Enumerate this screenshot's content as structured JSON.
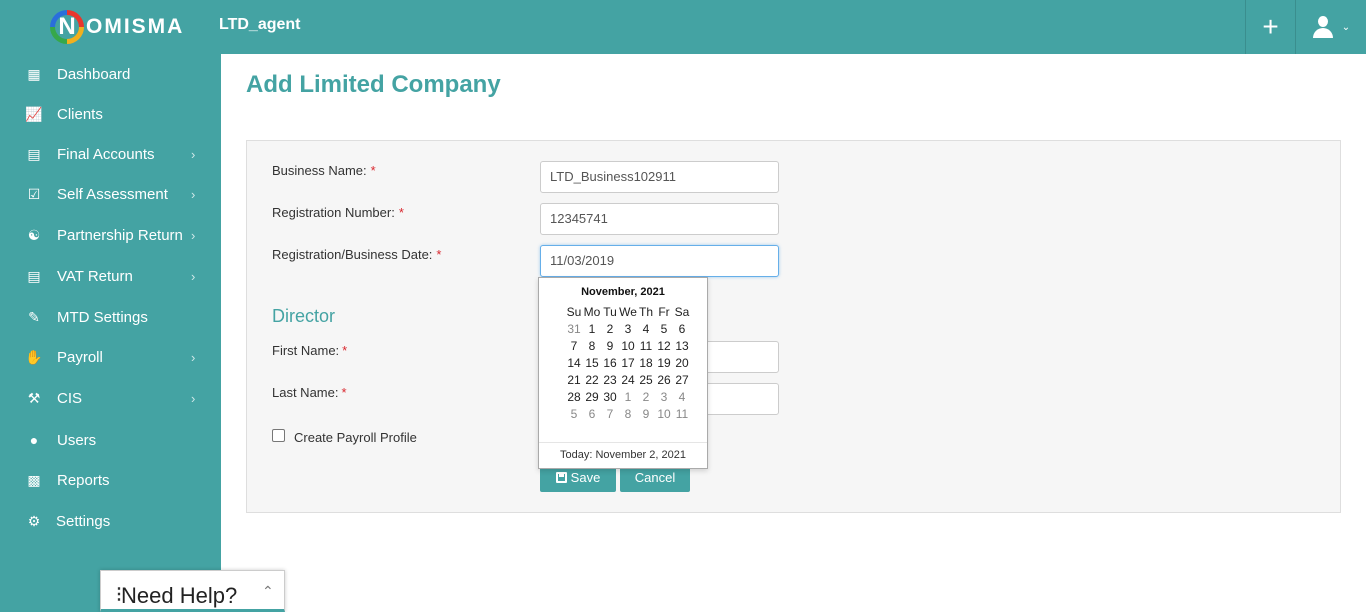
{
  "header": {
    "logo_text": "OMISMA",
    "logo_letter": "N",
    "app_title": "LTD_agent",
    "plus_icon": "plus-icon",
    "user_icon": "user-icon"
  },
  "sidebar": {
    "items": [
      {
        "label": "Dashboard",
        "icon": "dashboard-icon",
        "chevron": false
      },
      {
        "label": "Clients",
        "icon": "chart-icon",
        "chevron": false
      },
      {
        "label": "Final Accounts",
        "icon": "document-icon",
        "chevron": true
      },
      {
        "label": "Self Assessment",
        "icon": "checklist-icon",
        "chevron": true
      },
      {
        "label": "Partnership Return",
        "icon": "handshake-icon",
        "chevron": true
      },
      {
        "label": "VAT Return",
        "icon": "vat-icon",
        "chevron": true
      },
      {
        "label": "MTD Settings",
        "icon": "ledger-icon",
        "chevron": false
      },
      {
        "label": "Payroll",
        "icon": "payroll-icon",
        "chevron": true
      },
      {
        "label": "CIS",
        "icon": "tools-icon",
        "chevron": true
      },
      {
        "label": "Users",
        "icon": "user-icon",
        "chevron": false
      },
      {
        "label": "Reports",
        "icon": "clipboard-icon",
        "chevron": false
      },
      {
        "label": "Settings",
        "icon": "gear-icon",
        "chevron": false
      }
    ]
  },
  "main": {
    "title": "Add Limited Company",
    "form": {
      "business_name_label": "Business Name:",
      "business_name_value": "LTD_Business102911",
      "registration_number_label": "Registration Number:",
      "registration_number_value": "12345741",
      "registration_date_label": "Registration/Business Date:",
      "registration_date_value": "11/03/2019",
      "required_mark": "*",
      "director_heading": "Director",
      "first_name_label": "First Name:",
      "last_name_label": "Last Name:",
      "create_payroll_label": "Create Payroll Profile",
      "save_label": "Save",
      "cancel_label": "Cancel"
    }
  },
  "datepicker": {
    "title": "November, 2021",
    "weekdays": [
      "Su",
      "Mo",
      "Tu",
      "We",
      "Th",
      "Fr",
      "Sa"
    ],
    "weeks": [
      [
        {
          "d": "31",
          "m": true
        },
        {
          "d": "1"
        },
        {
          "d": "2"
        },
        {
          "d": "3"
        },
        {
          "d": "4"
        },
        {
          "d": "5"
        },
        {
          "d": "6"
        }
      ],
      [
        {
          "d": "7"
        },
        {
          "d": "8"
        },
        {
          "d": "9"
        },
        {
          "d": "10"
        },
        {
          "d": "11"
        },
        {
          "d": "12"
        },
        {
          "d": "13"
        }
      ],
      [
        {
          "d": "14"
        },
        {
          "d": "15"
        },
        {
          "d": "16"
        },
        {
          "d": "17"
        },
        {
          "d": "18"
        },
        {
          "d": "19"
        },
        {
          "d": "20"
        }
      ],
      [
        {
          "d": "21"
        },
        {
          "d": "22"
        },
        {
          "d": "23"
        },
        {
          "d": "24"
        },
        {
          "d": "25"
        },
        {
          "d": "26"
        },
        {
          "d": "27"
        }
      ],
      [
        {
          "d": "28"
        },
        {
          "d": "29"
        },
        {
          "d": "30"
        },
        {
          "d": "1",
          "m": true
        },
        {
          "d": "2",
          "m": true
        },
        {
          "d": "3",
          "m": true
        },
        {
          "d": "4",
          "m": true
        }
      ],
      [
        {
          "d": "5",
          "m": true
        },
        {
          "d": "6",
          "m": true
        },
        {
          "d": "7",
          "m": true
        },
        {
          "d": "8",
          "m": true
        },
        {
          "d": "9",
          "m": true
        },
        {
          "d": "10",
          "m": true
        },
        {
          "d": "11",
          "m": true
        }
      ]
    ],
    "today_label": "Today: November 2, 2021"
  },
  "help_widget": {
    "label": "Need Help?"
  },
  "colors": {
    "brand": "#44a3a3",
    "required": "#d9272e"
  }
}
